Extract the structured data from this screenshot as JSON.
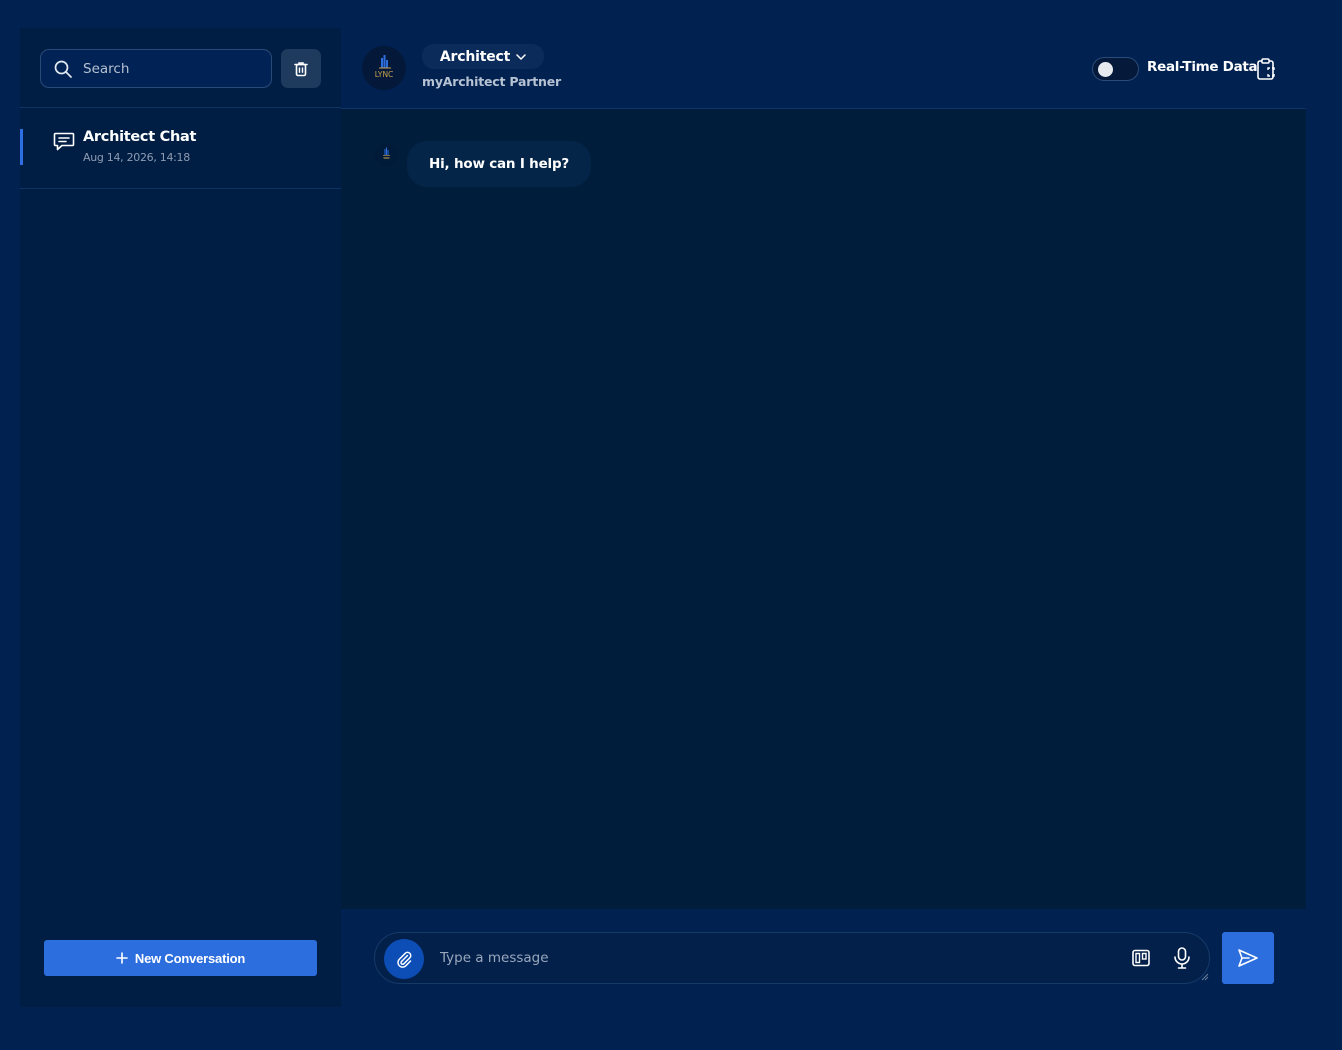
{
  "colors": {
    "page_bg": "#012150",
    "sidebar_bg": "#001e44",
    "chat_bg": "#001e3c",
    "accent": "#2d6ede",
    "attach_blue": "#0d4eb6",
    "bubble_bg": "#042548"
  },
  "sidebar": {
    "search_placeholder": "Search",
    "search_icon": "search-icon",
    "delete_icon": "trash-icon",
    "conversations": [
      {
        "title": "Architect Chat",
        "date": "Aug 14, 2026, 14:18",
        "icon": "chat-bubble-icon",
        "active": true
      }
    ],
    "new_conversation_label": "New Conversation",
    "new_conversation_icon": "plus-icon"
  },
  "header": {
    "logo_text": "LYNC",
    "agent_name": "Architect",
    "agent_subtitle": "myArchitect Partner",
    "realtime_label": "Real-Time Data",
    "realtime_enabled": false,
    "clipboard_icon": "clipboard-icon"
  },
  "chat": {
    "messages": [
      {
        "sender": "assistant",
        "text": "Hi, how can I help?"
      }
    ]
  },
  "composer": {
    "placeholder": "Type a message",
    "attach_icon": "paperclip-icon",
    "board_icon": "kanban-icon",
    "mic_icon": "microphone-icon",
    "send_icon": "send-icon"
  }
}
